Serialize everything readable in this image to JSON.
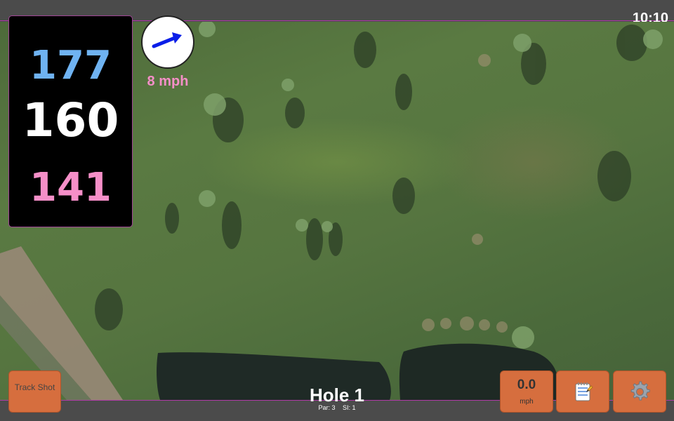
{
  "status": {
    "clock": "10:10"
  },
  "distances": {
    "back": "177",
    "center": "160",
    "front": "141"
  },
  "wind": {
    "speed_label": "8 mph",
    "direction_icon": "wind-arrow-icon",
    "arrow_color": "#0a1ee8"
  },
  "hole": {
    "title": "Hole 1",
    "par_label": "Par: 3",
    "si_label": "SI: 1"
  },
  "buttons": {
    "track_shot": "Track Shot",
    "wind_value": "0.0",
    "wind_unit": "mph",
    "notes_icon": "notepad-icon",
    "settings_icon": "gear-icon"
  },
  "colors": {
    "accent": "#b03aa8",
    "button": "#d66e3e",
    "back_distance": "#6fb3f2",
    "front_distance": "#f58fc8"
  }
}
